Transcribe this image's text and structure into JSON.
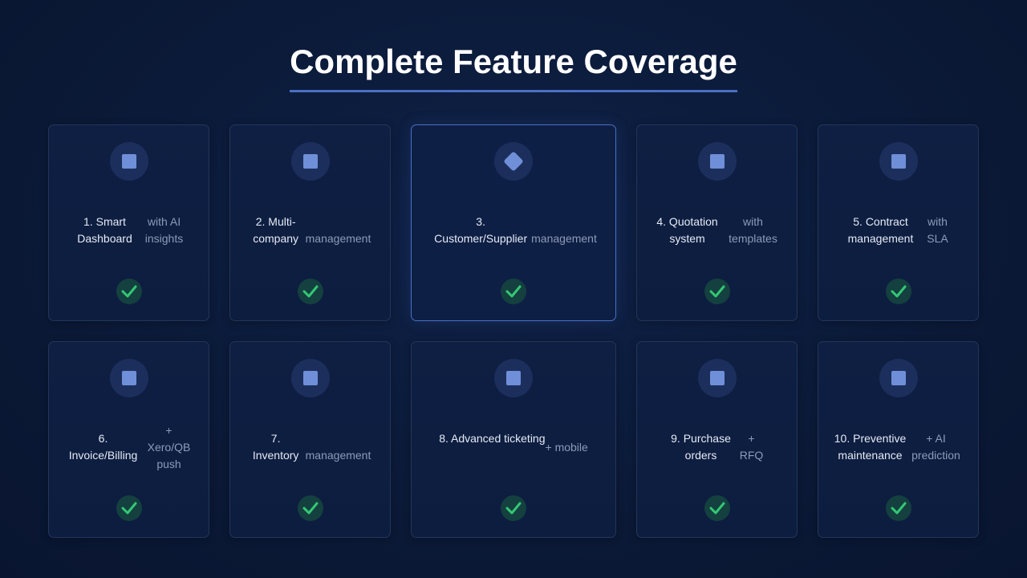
{
  "title": "Complete Feature Coverage",
  "colors": {
    "accent": "#4a6fc4",
    "icon": "#6f8fd8",
    "check": "#34c774"
  },
  "features": [
    {
      "main": "1. Smart Dashboard",
      "sub": "with AI insights",
      "icon": "square-icon"
    },
    {
      "main": "2. Multi-company",
      "sub": "management",
      "icon": "square-icon"
    },
    {
      "main": "3. Customer/Supplier",
      "sub": "management",
      "icon": "diamond-icon"
    },
    {
      "main": "4. Quotation system",
      "sub": "with templates",
      "icon": "square-icon"
    },
    {
      "main": "5. Contract management",
      "sub": "with SLA",
      "icon": "square-icon"
    },
    {
      "main": "6. Invoice/Billing",
      "sub": "+ Xero/QB push",
      "icon": "square-icon"
    },
    {
      "main": "7. Inventory",
      "sub": "management",
      "icon": "square-icon"
    },
    {
      "main": "8. Advanced ticketing",
      "sub": "+ mobile",
      "icon": "square-icon"
    },
    {
      "main": "9. Purchase orders",
      "sub": "+ RFQ",
      "icon": "square-icon"
    },
    {
      "main": "10. Preventive maintenance",
      "sub": "+ AI prediction",
      "icon": "square-icon"
    }
  ]
}
